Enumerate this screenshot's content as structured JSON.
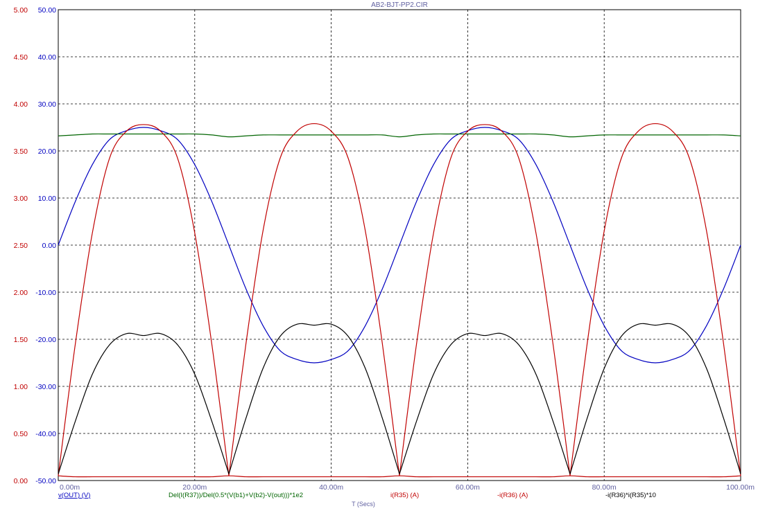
{
  "chart_data": {
    "type": "line",
    "title": "AB2-BJT-PP2.CIR",
    "xlabel": "T (Secs)",
    "x_axis": {
      "range": [
        0,
        0.1
      ],
      "ticks": [
        0,
        0.02,
        0.04,
        0.06,
        0.08,
        0.1
      ],
      "tick_labels": [
        "0.00m",
        "20.00m",
        "40.00m",
        "60.00m",
        "80.00m",
        "100.00m"
      ]
    },
    "y_axis_left": {
      "range": [
        0,
        5
      ],
      "ticks": [
        0,
        0.5,
        1,
        1.5,
        2,
        2.5,
        3,
        3.5,
        4,
        4.5,
        5
      ],
      "tick_labels": [
        "0.00",
        "0.50",
        "1.00",
        "1.50",
        "2.00",
        "2.50",
        "3.00",
        "3.50",
        "4.00",
        "4.50",
        "5.00"
      ],
      "color": "#c00000"
    },
    "y_axis_right": {
      "range": [
        -50,
        50
      ],
      "ticks": [
        -50,
        -40,
        -30,
        -20,
        -10,
        0,
        10,
        20,
        30,
        40,
        50
      ],
      "tick_labels": [
        "-50.00",
        "-40.00",
        "-30.00",
        "-20.00",
        "-10.00",
        "0.00",
        "10.00",
        "20.00",
        "30.00",
        "40.00",
        "50.00"
      ],
      "color": "#0000c0"
    },
    "grid": true,
    "x": [
      0,
      0.0025,
      0.005,
      0.0075,
      0.01,
      0.0125,
      0.015,
      0.0175,
      0.02,
      0.0225,
      0.025,
      0.0275,
      0.03,
      0.0325,
      0.035,
      0.0375,
      0.04,
      0.0425,
      0.045,
      0.0475,
      0.05,
      0.0525,
      0.055,
      0.0575,
      0.06,
      0.0625,
      0.065,
      0.0675,
      0.07,
      0.0725,
      0.075,
      0.0775,
      0.08,
      0.0825,
      0.085,
      0.0875,
      0.09,
      0.0925,
      0.095,
      0.0975,
      0.1
    ],
    "series": [
      {
        "name": "v(OUT) (V)",
        "color": "#0000c0",
        "axis": "right",
        "values": [
          0,
          9.27,
          17.1,
          22.4,
          24.3,
          25.0,
          24.3,
          22.4,
          17.1,
          9.27,
          0,
          -9.27,
          -17.1,
          -22.4,
          -24.3,
          -25.0,
          -24.3,
          -22.4,
          -17.1,
          -9.27,
          0,
          9.27,
          17.1,
          22.4,
          24.3,
          25.0,
          24.3,
          22.4,
          17.1,
          9.27,
          0,
          -9.27,
          -17.1,
          -22.4,
          -24.3,
          -25.0,
          -24.3,
          -22.4,
          -17.1,
          -9.27,
          0
        ]
      },
      {
        "name": "Del(I(R37))/Del(0.5*(V(b1)+V(b2)-V(out)))*1e2",
        "color": "#006400",
        "axis": "left",
        "values": [
          3.66,
          3.67,
          3.68,
          3.68,
          3.68,
          3.68,
          3.68,
          3.68,
          3.68,
          3.67,
          3.65,
          3.66,
          3.67,
          3.67,
          3.67,
          3.67,
          3.67,
          3.67,
          3.67,
          3.67,
          3.65,
          3.67,
          3.68,
          3.68,
          3.68,
          3.68,
          3.68,
          3.68,
          3.68,
          3.67,
          3.65,
          3.66,
          3.67,
          3.67,
          3.67,
          3.67,
          3.67,
          3.67,
          3.67,
          3.67,
          3.66
        ]
      },
      {
        "name": "i(R35) (A)",
        "color": "#c00000",
        "axis": "left",
        "values": [
          0.05,
          1.45,
          2.63,
          3.42,
          3.71,
          3.78,
          3.71,
          3.42,
          2.63,
          1.45,
          0.05,
          1.45,
          2.65,
          3.42,
          3.71,
          3.79,
          3.71,
          3.42,
          2.65,
          1.45,
          0.05,
          1.45,
          2.63,
          3.42,
          3.71,
          3.78,
          3.71,
          3.42,
          2.63,
          1.45,
          0.05,
          1.45,
          2.65,
          3.42,
          3.71,
          3.79,
          3.71,
          3.42,
          2.65,
          1.45,
          0.05
        ]
      },
      {
        "name": "-i(R36) (A)",
        "color": "#c00000",
        "axis": "left",
        "values": [
          0.05,
          0.04,
          0.04,
          0.04,
          0.04,
          0.04,
          0.04,
          0.04,
          0.04,
          0.04,
          0.05,
          0.04,
          0.04,
          0.04,
          0.04,
          0.04,
          0.04,
          0.04,
          0.04,
          0.04,
          0.05,
          0.04,
          0.04,
          0.04,
          0.04,
          0.04,
          0.04,
          0.04,
          0.04,
          0.04,
          0.05,
          0.04,
          0.04,
          0.04,
          0.04,
          0.04,
          0.04,
          0.04,
          0.04,
          0.04,
          0.05
        ]
      },
      {
        "name": "-i(R36)*i(R35)*10",
        "color": "#000000",
        "axis": "left",
        "values": [
          0.07,
          0.63,
          1.13,
          1.44,
          1.56,
          1.54,
          1.56,
          1.44,
          1.13,
          0.63,
          0.07,
          0.66,
          1.19,
          1.53,
          1.66,
          1.65,
          1.66,
          1.53,
          1.19,
          0.66,
          0.07,
          0.63,
          1.13,
          1.44,
          1.56,
          1.54,
          1.56,
          1.44,
          1.13,
          0.63,
          0.07,
          0.66,
          1.19,
          1.53,
          1.66,
          1.65,
          1.66,
          1.53,
          1.19,
          0.66,
          0.07
        ]
      }
    ]
  }
}
